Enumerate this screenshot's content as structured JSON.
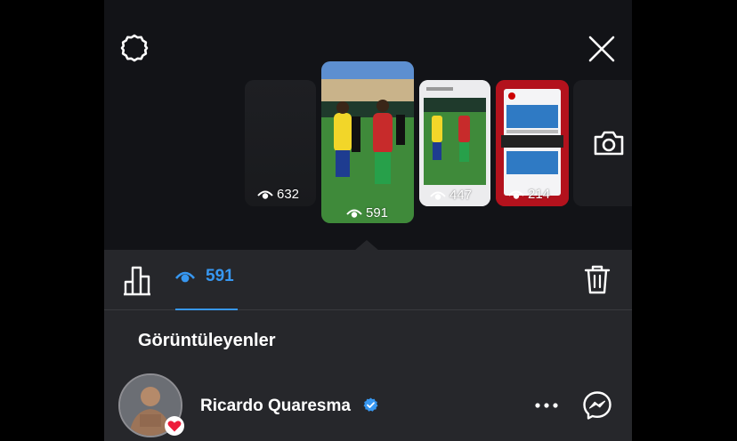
{
  "header": {
    "settings_icon": "settings-gear-icon",
    "close_icon": "close-x-icon"
  },
  "stories": [
    {
      "views": "632"
    },
    {
      "views": "591",
      "selected": true
    },
    {
      "views": "447"
    },
    {
      "views": "214"
    },
    {
      "camera_icon": "camera-icon"
    }
  ],
  "toolbar": {
    "insights_icon": "bar-chart-icon",
    "views_icon": "eye-icon",
    "views_count": "591",
    "delete_icon": "trash-icon"
  },
  "viewers_section": {
    "title": "Görüntüleyenler"
  },
  "viewers": [
    {
      "name": "Ricardo Quaresma",
      "verified": true,
      "liked": true
    }
  ],
  "colors": {
    "accent": "#3797f0",
    "background": "#121317",
    "panel": "#26272b",
    "heart": "#ed1c3a"
  }
}
